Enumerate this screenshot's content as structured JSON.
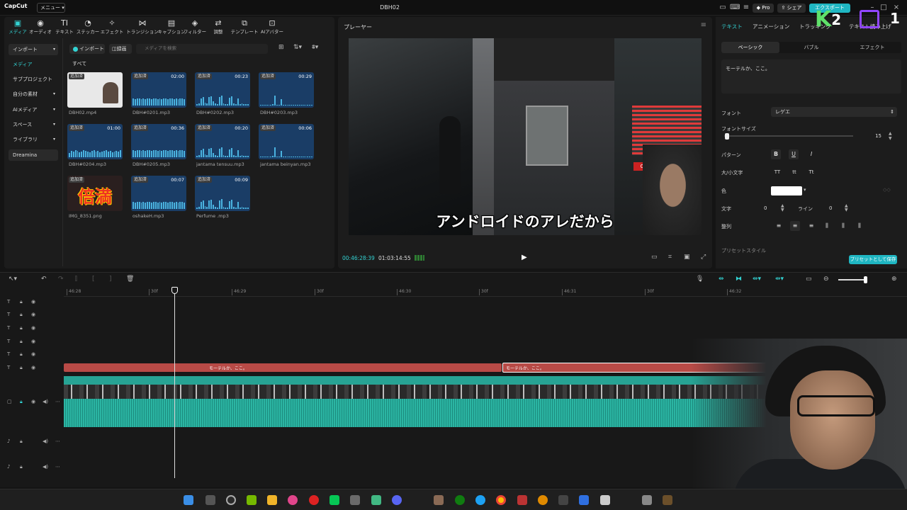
{
  "app": {
    "logo": "CapCut",
    "menu_label": "メニュー",
    "project_title": "DBH02",
    "pro_label": "Pro",
    "share_label": "シェア",
    "export_label": "エクスポート"
  },
  "toolbar": {
    "tabs": [
      {
        "label": "メディア",
        "icon": "media-icon"
      },
      {
        "label": "オーディオ",
        "icon": "audio-icon"
      },
      {
        "label": "テキスト",
        "icon": "text-icon"
      },
      {
        "label": "ステッカー",
        "icon": "sticker-icon"
      },
      {
        "label": "エフェクト",
        "icon": "effect-icon"
      },
      {
        "label": "トランジション",
        "icon": "transition-icon"
      },
      {
        "label": "キャプション",
        "icon": "caption-icon"
      },
      {
        "label": "フィルター",
        "icon": "filter-icon"
      },
      {
        "label": "調整",
        "icon": "adjust-icon"
      },
      {
        "label": "テンプレート",
        "icon": "template-icon"
      },
      {
        "label": "AIアバター",
        "icon": "ai-avatar-icon"
      }
    ]
  },
  "media": {
    "sidebar": [
      {
        "label": "インポート"
      },
      {
        "label": "メディア"
      },
      {
        "label": "サブプロジェクト"
      },
      {
        "label": "自分の素材"
      },
      {
        "label": "AIメディア"
      },
      {
        "label": "スペース"
      },
      {
        "label": "ライブラリ"
      },
      {
        "label": "Dreamina"
      }
    ],
    "import_btn": "インポート",
    "record_btn": "録画",
    "search_placeholder": "メディアを検索",
    "all_label": "すべて",
    "added_badge": "追加済",
    "items": [
      {
        "name": "DBH02.mp4",
        "duration": "",
        "kind": "video"
      },
      {
        "name": "DBH#0201.mp3",
        "duration": "02:00",
        "kind": "audio"
      },
      {
        "name": "DBH#0202.mp3",
        "duration": "00:23",
        "kind": "audio"
      },
      {
        "name": "DBH#0203.mp3",
        "duration": "00:29",
        "kind": "audio"
      },
      {
        "name": "DBH#0204.mp3",
        "duration": "01:00",
        "kind": "audio"
      },
      {
        "name": "DBH#0205.mp3",
        "duration": "00:36",
        "kind": "audio"
      },
      {
        "name": "jantama tensuu.mp3",
        "duration": "00:20",
        "kind": "audio"
      },
      {
        "name": "jantama beinyan.mp3",
        "duration": "00:06",
        "kind": "audio"
      },
      {
        "name": "IMG_8351.png",
        "duration": "",
        "kind": "image"
      },
      {
        "name": "oshakeH.mp3",
        "duration": "00:07",
        "kind": "audio"
      },
      {
        "name": "Perfume .mp3",
        "duration": "00:09",
        "kind": "audio"
      }
    ],
    "image_text": "倍満"
  },
  "player": {
    "label": "プレーヤー",
    "subtitle": "アンドロイドのアレだから",
    "sign_on": "ON",
    "time_current": "00:46:28:39",
    "time_total": "01:03:14:55"
  },
  "properties": {
    "tabs": [
      "テキスト",
      "アニメーション",
      "トラッキング",
      "テキスト読み上げ"
    ],
    "subtabs": [
      "ベーシック",
      "バブル",
      "エフェクト"
    ],
    "text_value": "モーテルか、ここ。",
    "font_label": "フォント",
    "font_value": "レゲエ",
    "fontsize_label": "フォントサイズ",
    "fontsize_value": "15",
    "pattern_label": "パターン",
    "case_label": "大/小文字",
    "color_label": "色",
    "char_label": "文字",
    "char_value": "0",
    "line_label": "ライン",
    "line_value": "0",
    "align_label": "整列",
    "preset_label": "プリセットスタイル",
    "save_preset": "プリセットとして保存"
  },
  "timeline": {
    "ruler": [
      "46:28",
      "30f",
      "46:29",
      "30f",
      "46:30",
      "30f",
      "46:31",
      "30f",
      "46:32"
    ],
    "text_clip1": "モーテルか、ここ。",
    "text_clip2": "モーテルか、ここ。"
  },
  "overlay": {
    "k2": "K",
    "k2_num": "2",
    "num": "1"
  },
  "colors": {
    "accent": "#33d3d3",
    "text_clip": "#b84a46",
    "video_clip": "#27a394",
    "export": "#1fb6c2"
  }
}
